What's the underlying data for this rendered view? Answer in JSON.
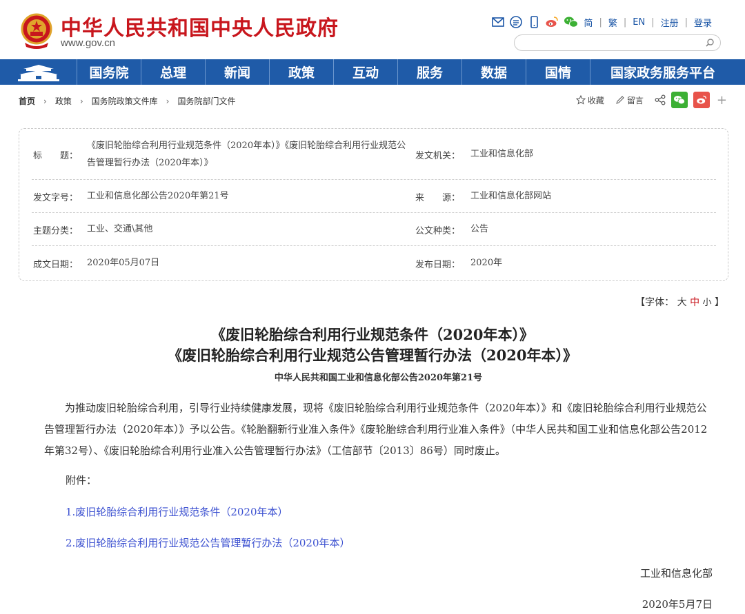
{
  "header": {
    "site_title": "中华人民共和国中央人民政府",
    "site_url": "www.gov.cn",
    "lang_simplified": "简",
    "lang_traditional": "繁",
    "lang_en": "EN",
    "register": "注册",
    "login": "登录",
    "search_placeholder": ""
  },
  "nav": {
    "items": [
      "国务院",
      "总理",
      "新闻",
      "政策",
      "互动",
      "服务",
      "数据",
      "国情",
      "国家政务服务平台"
    ]
  },
  "breadcrumb": [
    "首页",
    "政策",
    "国务院政策文件库",
    "国务院部门文件"
  ],
  "share": {
    "favorite": "收藏",
    "comment": "留言",
    "plus": "+"
  },
  "info": {
    "title_label": "标　　题：",
    "title_value": "《废旧轮胎综合利用行业规范条件（2020年本）》《废旧轮胎综合利用行业规范公告管理暂行办法（2020年本）》",
    "issuer_label": "发文机关：",
    "issuer_value": "工业和信息化部",
    "doc_no_label": "发文字号：",
    "doc_no_value": "工业和信息化部公告2020年第21号",
    "source_label": "来　　源：",
    "source_value": "工业和信息化部网站",
    "topic_label": "主题分类：",
    "topic_value": "工业、交通\\其他",
    "type_label": "公文种类：",
    "type_value": "公告",
    "written_label": "成文日期：",
    "written_value": "2020年05月07日",
    "published_label": "发布日期：",
    "published_value": "2020年"
  },
  "font_size": {
    "prefix": "【字体：",
    "big": "大",
    "mid": "中",
    "small": "小",
    "suffix": "】"
  },
  "article": {
    "title_line1": "《废旧轮胎综合利用行业规范条件（2020年本）》",
    "title_line2": "《废旧轮胎综合利用行业规范公告管理暂行办法（2020年本）》",
    "subtitle": "中华人民共和国工业和信息化部公告2020年第21号",
    "body": "为推动废旧轮胎综合利用，引导行业持续健康发展，现将《废旧轮胎综合利用行业规范条件（2020年本）》和《废旧轮胎综合利用行业规范公告管理暂行办法（2020年本）》予以公告。《轮胎翻新行业准入条件》《废轮胎综合利用行业准入条件》（中华人民共和国工业和信息化部公告2012年第32号）、《废旧轮胎综合利用行业准入公告管理暂行办法》（工信部节〔2013〕86号）同时废止。",
    "annex_label": "附件：",
    "annex_1": "1.废旧轮胎综合利用行业规范条件（2020年本）",
    "annex_2": "2.废旧轮胎综合利用行业规范公告管理暂行办法（2020年本）",
    "signer": "工业和信息化部",
    "date": "2020年5月7日"
  },
  "colors": {
    "brand_red": "#c8161d",
    "nav_blue": "#1f5ba8",
    "link_blue": "#3a4fd0",
    "wechat_green": "#3cb034",
    "weibo_red": "#e8534a"
  },
  "icons": [
    "national-emblem-icon",
    "mail-icon",
    "rss-icon",
    "mobile-icon",
    "weibo-icon",
    "wechat-icon",
    "search-icon",
    "tiananmen-icon",
    "star-icon",
    "pencil-icon",
    "share-icon"
  ]
}
